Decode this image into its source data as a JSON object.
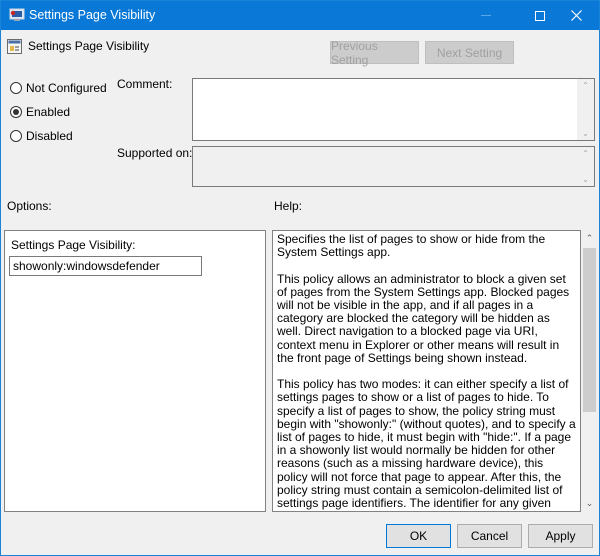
{
  "window": {
    "title": "Settings Page Visibility",
    "controls": {
      "minimize": "minimize",
      "maximize": "maximize",
      "close": "close"
    }
  },
  "header": {
    "policy_title": "Settings Page Visibility",
    "previous_label": "Previous Setting",
    "next_label": "Next Setting"
  },
  "state": {
    "options": [
      {
        "label": "Not Configured",
        "checked": false
      },
      {
        "label": "Enabled",
        "checked": true
      },
      {
        "label": "Disabled",
        "checked": false
      }
    ]
  },
  "fields": {
    "comment_label": "Comment:",
    "comment_value": "",
    "supported_label": "Supported on:",
    "supported_value": ""
  },
  "sections": {
    "options_label": "Options:",
    "help_label": "Help:"
  },
  "options_panel": {
    "field_label": "Settings Page Visibility:",
    "field_value": "showonly:windowsdefender"
  },
  "help": {
    "paragraphs": [
      "Specifies the list of pages to show or hide from the System Settings app.",
      "This policy allows an administrator to block a given set of pages from the System Settings app. Blocked pages will not be visible in the app, and if all pages in a category are blocked the category will be hidden as well. Direct navigation to a blocked page via URI, context menu in Explorer or other means will result in the front page of Settings being shown instead.",
      "This policy has two modes: it can either specify a list of settings pages to show or a list of pages to hide. To specify a list of pages to show, the policy string must begin with \"showonly:\" (without quotes), and to specify a list of pages to hide, it must begin with \"hide:\". If a page in a showonly list would normally be hidden for other reasons (such as a missing hardware device), this policy will not force that page to appear. After this, the policy string must contain a semicolon-delimited list of settings page identifiers. The identifier for any given settings page is the published URI for that page, minus the \"ms-settings:\" protocol part."
    ]
  },
  "footer": {
    "ok_label": "OK",
    "cancel_label": "Cancel",
    "apply_label": "Apply"
  },
  "colors": {
    "titlebar": "#0a78d7",
    "accent": "#0078d7"
  }
}
